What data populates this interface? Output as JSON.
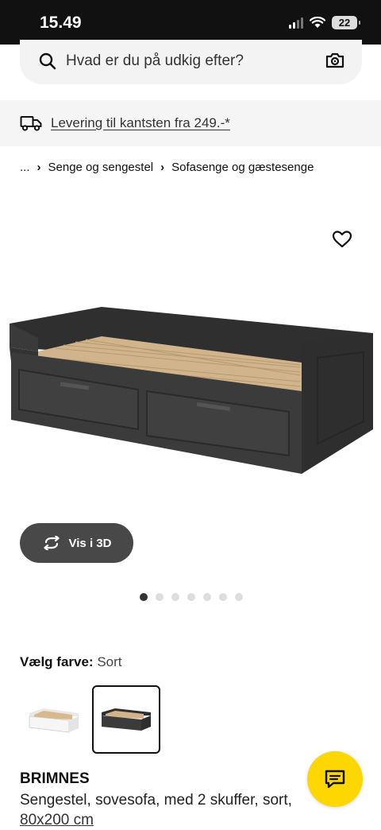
{
  "status_bar": {
    "time": "15.49",
    "battery": "22"
  },
  "search": {
    "placeholder": "Hvad er du på udkig efter?"
  },
  "delivery": {
    "text": "Levering til kantsten fra 249.-*"
  },
  "breadcrumb": {
    "ellipsis": "...",
    "items": [
      "Senge og sengestel",
      "Sofasenge og gæstesenge"
    ]
  },
  "view_3d": {
    "label": "Vis i 3D"
  },
  "carousel": {
    "count": 7,
    "active_index": 0
  },
  "color_selector": {
    "label": "Vælg farve:",
    "value": "Sort"
  },
  "product": {
    "name": "BRIMNES",
    "description": "Sengestel, sovesofa, med 2 skuffer, sort,",
    "size": "80x200 cm"
  },
  "colors": {
    "accent_yellow": "#ffd700",
    "dark_button": "#484848"
  }
}
